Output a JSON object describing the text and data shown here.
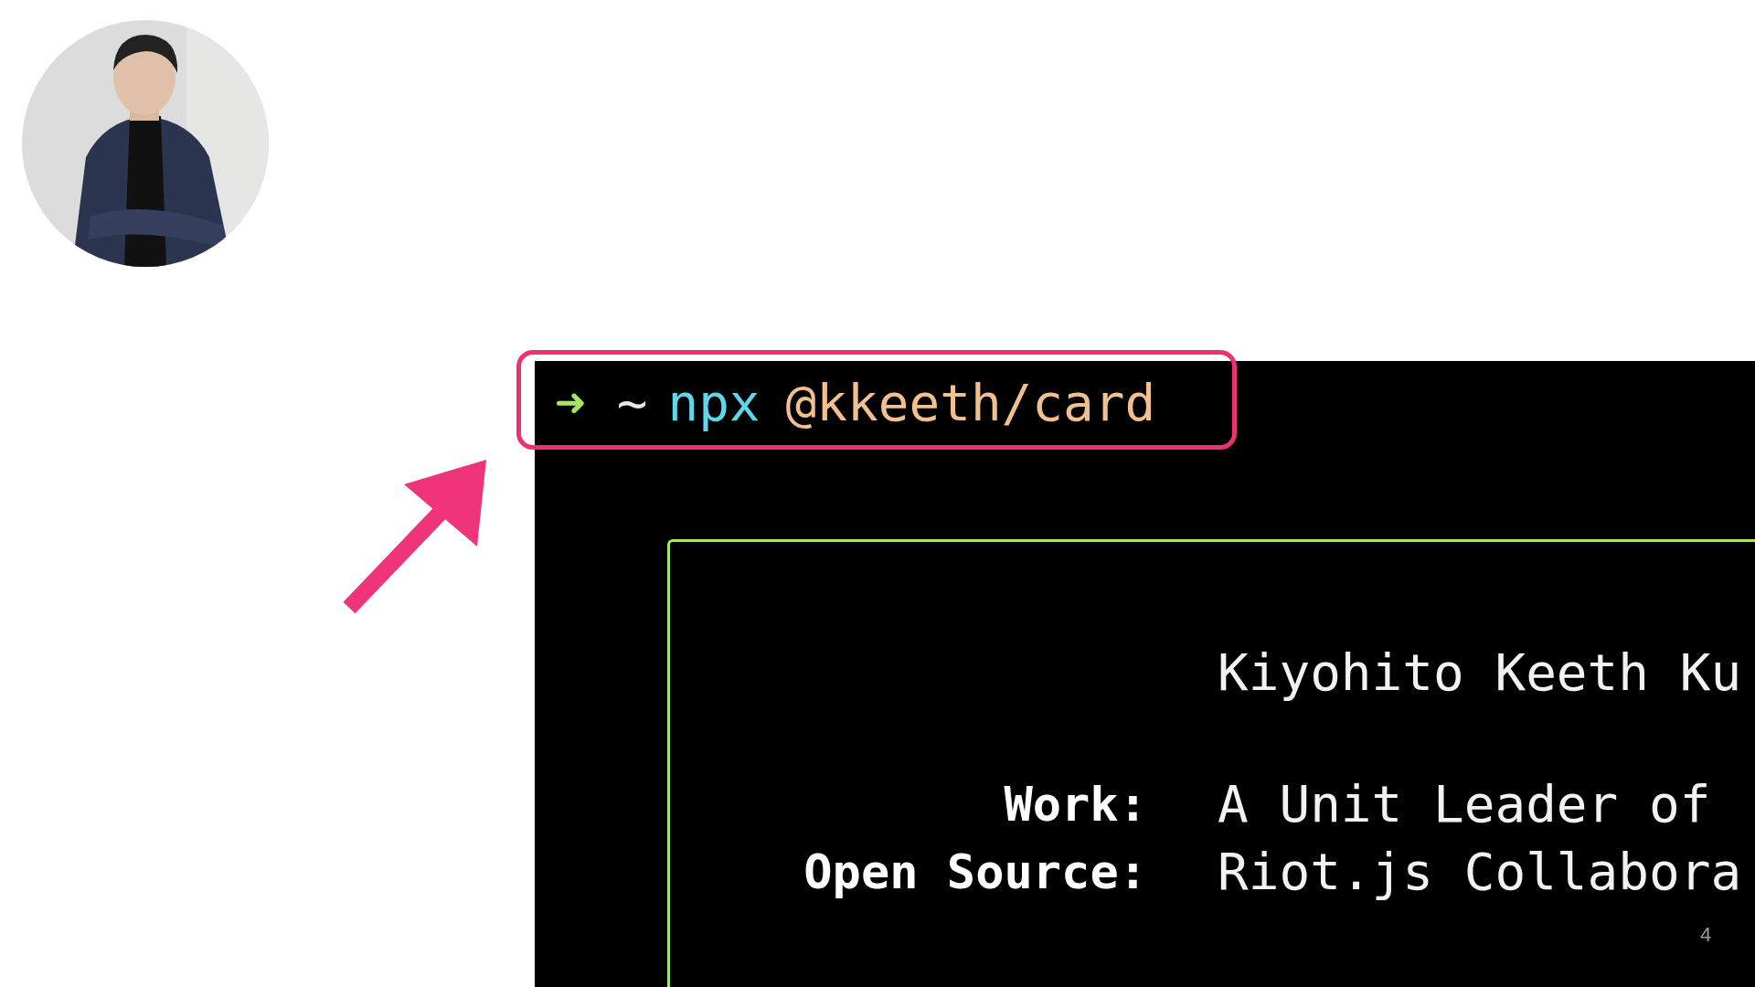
{
  "terminal": {
    "prompt": {
      "symbol": "➜",
      "cwd": "~",
      "command": "npx",
      "argument": "@kkeeth/card"
    },
    "card": {
      "name": "Kiyohito Keeth Ku",
      "rows": [
        {
          "label": "Work:",
          "value": "A Unit Leader of"
        },
        {
          "label": "Open Source:",
          "value": "Riot.js Collabora"
        }
      ]
    }
  },
  "page_number": "4"
}
